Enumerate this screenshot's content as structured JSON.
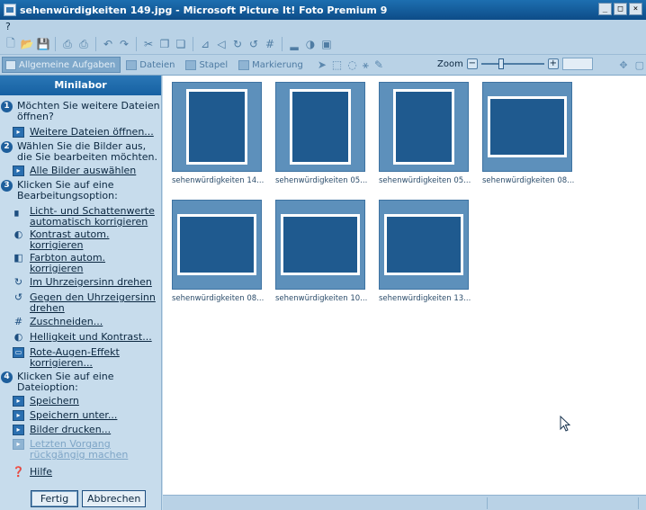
{
  "window": {
    "title": "sehenwürdigkeiten 149.jpg - Microsoft Picture It! Foto Premium 9",
    "controls": [
      "_",
      "□",
      "×"
    ]
  },
  "menu": {
    "items": [
      "?"
    ]
  },
  "toolbar": {
    "icons": [
      "new-icon",
      "open-icon",
      "save-icon",
      "scan-icon",
      "print-icon",
      "undo-icon",
      "redo-icon",
      "cut-icon",
      "copy-icon",
      "paste-icon",
      "flip-icon",
      "rotate-left-icon",
      "rotate-right-icon",
      "rotate-icon",
      "crop-icon",
      "levels-icon",
      "contrast-icon",
      "redeye-icon"
    ]
  },
  "tabs": [
    {
      "label": "Allgemeine Aufgaben",
      "active": true
    },
    {
      "label": "Dateien",
      "active": false
    },
    {
      "label": "Stapel",
      "active": false
    },
    {
      "label": "Markierung",
      "active": false
    }
  ],
  "zoom": {
    "label": "Zoom",
    "minus": "−",
    "plus": "+",
    "level": 0.3
  },
  "sidebar": {
    "title": "Minilabor",
    "steps": [
      {
        "num": "1",
        "text": "Möchten Sie weitere Dateien öffnen?"
      },
      {
        "num": "2",
        "text": "Wählen Sie die Bilder aus, die Sie bearbeiten möchten."
      },
      {
        "num": "3",
        "text": "Klicken Sie auf eine Bearbeitungsoption:"
      },
      {
        "num": "4",
        "text": "Klicken Sie auf eine Dateioption:"
      }
    ],
    "actions": {
      "more_files": "Weitere Dateien öffnen...",
      "select_all": "Alle Bilder auswählen",
      "auto_light": "Licht- und Schattenwerte automatisch korrigieren",
      "auto_contrast": "Kontrast autom. korrigieren",
      "auto_hue": "Farbton autom. korrigieren",
      "rotate_cw": "Im Uhrzeigersinn drehen",
      "rotate_ccw": "Gegen den Uhrzeigersinn drehen",
      "crop": "Zuschneiden...",
      "brightness": "Helligkeit und Kontrast...",
      "redeye": "Rote-Augen-Effekt korrigieren...",
      "save": "Speichern",
      "save_as": "Speichern unter...",
      "print": "Bilder drucken...",
      "undo_last": "Letzten Vorgang rückgängig machen",
      "help": "Hilfe"
    },
    "done_button": "Fertig",
    "cancel_button": "Abbrechen"
  },
  "thumbnails": [
    {
      "caption": "sehenwürdigkeiten 14...",
      "orientation": "portrait"
    },
    {
      "caption": "sehenwürdigkeiten 05...",
      "orientation": "portrait"
    },
    {
      "caption": "sehenwürdigkeiten 05...",
      "orientation": "portrait"
    },
    {
      "caption": "sehenwürdigkeiten 08...",
      "orientation": "landscape"
    },
    {
      "caption": "sehenwürdigkeiten 08...",
      "orientation": "landscape"
    },
    {
      "caption": "sehenwürdigkeiten 10...",
      "orientation": "landscape"
    },
    {
      "caption": "sehenwürdigkeiten 13...",
      "orientation": "landscape"
    }
  ]
}
